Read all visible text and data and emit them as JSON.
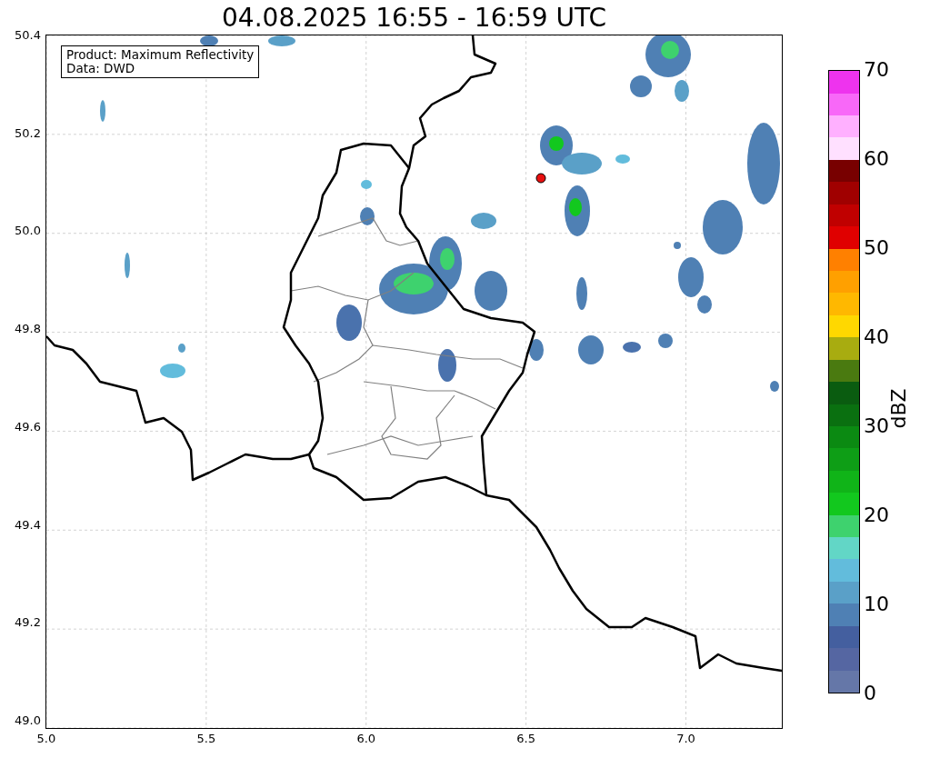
{
  "title": "04.08.2025 16:55 - 16:59 UTC",
  "legend": {
    "lines": [
      "Product: Maximum Reflectivity",
      "Data: DWD"
    ]
  },
  "map": {
    "xticks": [
      "5.0",
      "5.5",
      "6.0",
      "6.5",
      "7.0"
    ],
    "yticks": [
      "50.4",
      "50.2",
      "50.0",
      "49.8",
      "49.6",
      "49.4",
      "49.2",
      "49.0"
    ]
  },
  "colorbar": {
    "label": "dBZ",
    "ticks": [
      "70",
      "60",
      "50",
      "40",
      "30",
      "20",
      "10",
      "0"
    ],
    "bands": [
      {
        "color": "#6577a8"
      },
      {
        "color": "#5566a2"
      },
      {
        "color": "#445f9f"
      },
      {
        "color": "#4f80b4"
      },
      {
        "color": "#5aa0c8"
      },
      {
        "color": "#62bcdc"
      },
      {
        "color": "#62d6c6"
      },
      {
        "color": "#3ed26e"
      },
      {
        "color": "#12c81e"
      },
      {
        "color": "#10b418"
      },
      {
        "color": "#0e9e16"
      },
      {
        "color": "#0b8a12"
      },
      {
        "color": "#0a7010"
      },
      {
        "color": "#0a5c10"
      },
      {
        "color": "#4a7a10"
      },
      {
        "color": "#a8ac10"
      },
      {
        "color": "#ffd800"
      },
      {
        "color": "#ffb800"
      },
      {
        "color": "#ffa000"
      },
      {
        "color": "#ff8000"
      },
      {
        "color": "#e00000"
      },
      {
        "color": "#c00000"
      },
      {
        "color": "#a00000"
      },
      {
        "color": "#780000"
      },
      {
        "color": "#ffe0ff"
      },
      {
        "color": "#ffb0ff"
      },
      {
        "color": "#f868f8"
      },
      {
        "color": "#ee33ee"
      }
    ]
  }
}
